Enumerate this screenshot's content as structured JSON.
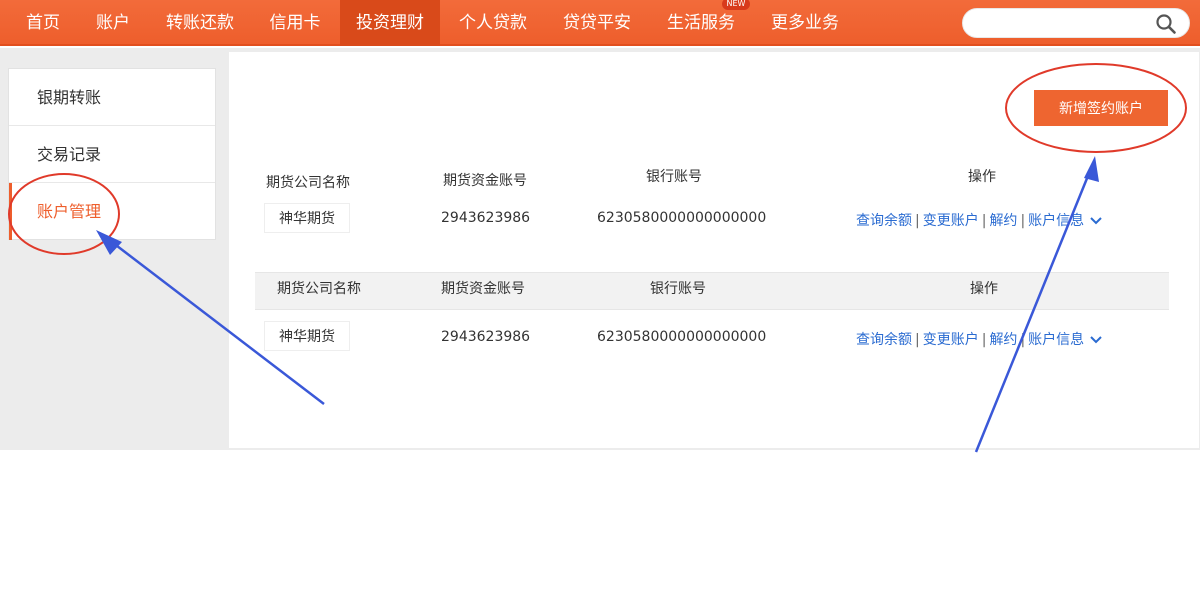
{
  "nav": {
    "items": [
      {
        "label": "首页"
      },
      {
        "label": "账户"
      },
      {
        "label": "转账还款"
      },
      {
        "label": "信用卡"
      },
      {
        "label": "投资理财"
      },
      {
        "label": "个人贷款"
      },
      {
        "label": "贷贷平安"
      },
      {
        "label": "生活服务"
      },
      {
        "label": "更多业务"
      }
    ],
    "active_index": 4,
    "badge": "NEW",
    "search_placeholder": ""
  },
  "sidebar": {
    "items": [
      {
        "label": "银期转账"
      },
      {
        "label": "交易记录"
      },
      {
        "label": "账户管理"
      }
    ],
    "active_index": 2
  },
  "main": {
    "add_button": "新增签约账户",
    "columns": [
      "期货公司名称",
      "期货资金账号",
      "银行账号",
      "操作"
    ],
    "rows": [
      {
        "company": "神华期货",
        "fund_account": "2943623986",
        "bank_account": "6230580000000000000"
      },
      {
        "company": "神华期货",
        "fund_account": "2943623986",
        "bank_account": "6230580000000000000"
      }
    ],
    "actions": [
      "查询余额",
      "变更账户",
      "解约",
      "账户信息"
    ]
  },
  "colors": {
    "brand": "#ee5e2c",
    "link": "#2a6bd1",
    "annotation_circle": "#e03a2a",
    "annotation_arrow": "#3a58d8"
  }
}
